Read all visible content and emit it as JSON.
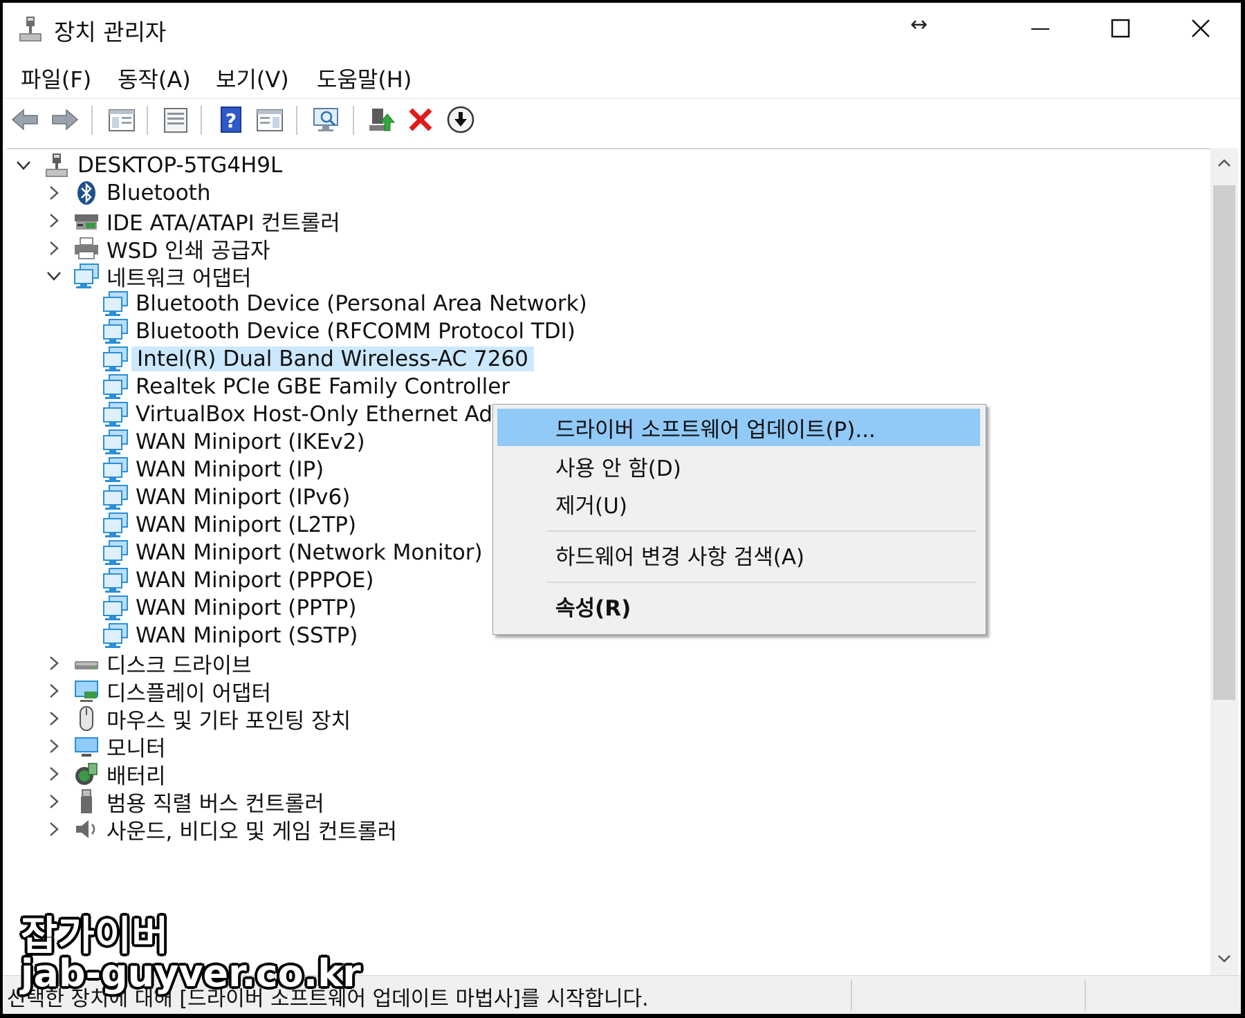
{
  "window": {
    "title": "장치 관리자",
    "resize_icon": "↔"
  },
  "menu": [
    {
      "label": "파일(F)"
    },
    {
      "label": "동작(A)"
    },
    {
      "label": "보기(V)"
    },
    {
      "label": "도움말(H)"
    }
  ],
  "toolbar": {
    "icons": [
      "back-arrow-icon",
      "forward-arrow-icon",
      "show-hide-console-tree-icon",
      "properties-icon",
      "help-icon",
      "action-pane-icon",
      "scan-hardware-icon",
      "update-driver-icon",
      "uninstall-icon",
      "disable-device-icon"
    ]
  },
  "tree": {
    "root": {
      "label": "DESKTOP-5TG4H9L"
    },
    "categories_before": [
      {
        "label": "Bluetooth",
        "icon": "bluetooth-icon"
      },
      {
        "label": "IDE ATA/ATAPI 컨트롤러",
        "icon": "ide-controller-icon"
      },
      {
        "label": "WSD 인쇄 공급자",
        "icon": "printer-icon"
      }
    ],
    "network": {
      "label": "네트워크 어댑터",
      "children": [
        {
          "label": "Bluetooth Device (Personal Area Network)"
        },
        {
          "label": "Bluetooth Device (RFCOMM Protocol TDI)"
        },
        {
          "label": "Intel(R) Dual Band Wireless-AC 7260",
          "selected": true
        },
        {
          "label": "Realtek PCIe GBE Family Controller"
        },
        {
          "label": "VirtualBox Host-Only Ethernet Adap"
        },
        {
          "label": "WAN Miniport (IKEv2)"
        },
        {
          "label": "WAN Miniport (IP)"
        },
        {
          "label": "WAN Miniport (IPv6)"
        },
        {
          "label": "WAN Miniport (L2TP)"
        },
        {
          "label": "WAN Miniport (Network Monitor)"
        },
        {
          "label": "WAN Miniport (PPPOE)"
        },
        {
          "label": "WAN Miniport (PPTP)"
        },
        {
          "label": "WAN Miniport (SSTP)"
        }
      ]
    },
    "categories_after": [
      {
        "label": "디스크 드라이브",
        "icon": "disk-drive-icon"
      },
      {
        "label": "디스플레이 어댑터",
        "icon": "display-adapter-icon"
      },
      {
        "label": "마우스 및 기타 포인팅 장치",
        "icon": "mouse-icon"
      },
      {
        "label": "모니터",
        "icon": "monitor-icon"
      },
      {
        "label": "배터리",
        "icon": "battery-icon"
      },
      {
        "label": "범용 직렬 버스 컨트롤러",
        "icon": "usb-icon"
      },
      {
        "label": "사운드, 비디오 및 게임 컨트롤러",
        "icon": "sound-icon"
      }
    ]
  },
  "context_menu": {
    "items": [
      {
        "label": "드라이버 소프트웨어 업데이트(P)..."
      },
      {
        "label": "사용 안 함(D)"
      },
      {
        "label": "제거(U)"
      },
      {
        "label": "하드웨어 변경 사항 검색(A)"
      },
      {
        "label": "속성(R)"
      }
    ]
  },
  "status_bar": {
    "text": "선택한 장치에 대해 [드라이버 소프트웨어 업데이트 마법사]를 시작합니다."
  },
  "watermark": {
    "name": "잡가이버",
    "url": "jab-guyver.co.kr"
  },
  "colors": {
    "selection": "#cce8ff",
    "menu_highlight": "#91c9f7",
    "network_icon": "#2a8fd6"
  }
}
